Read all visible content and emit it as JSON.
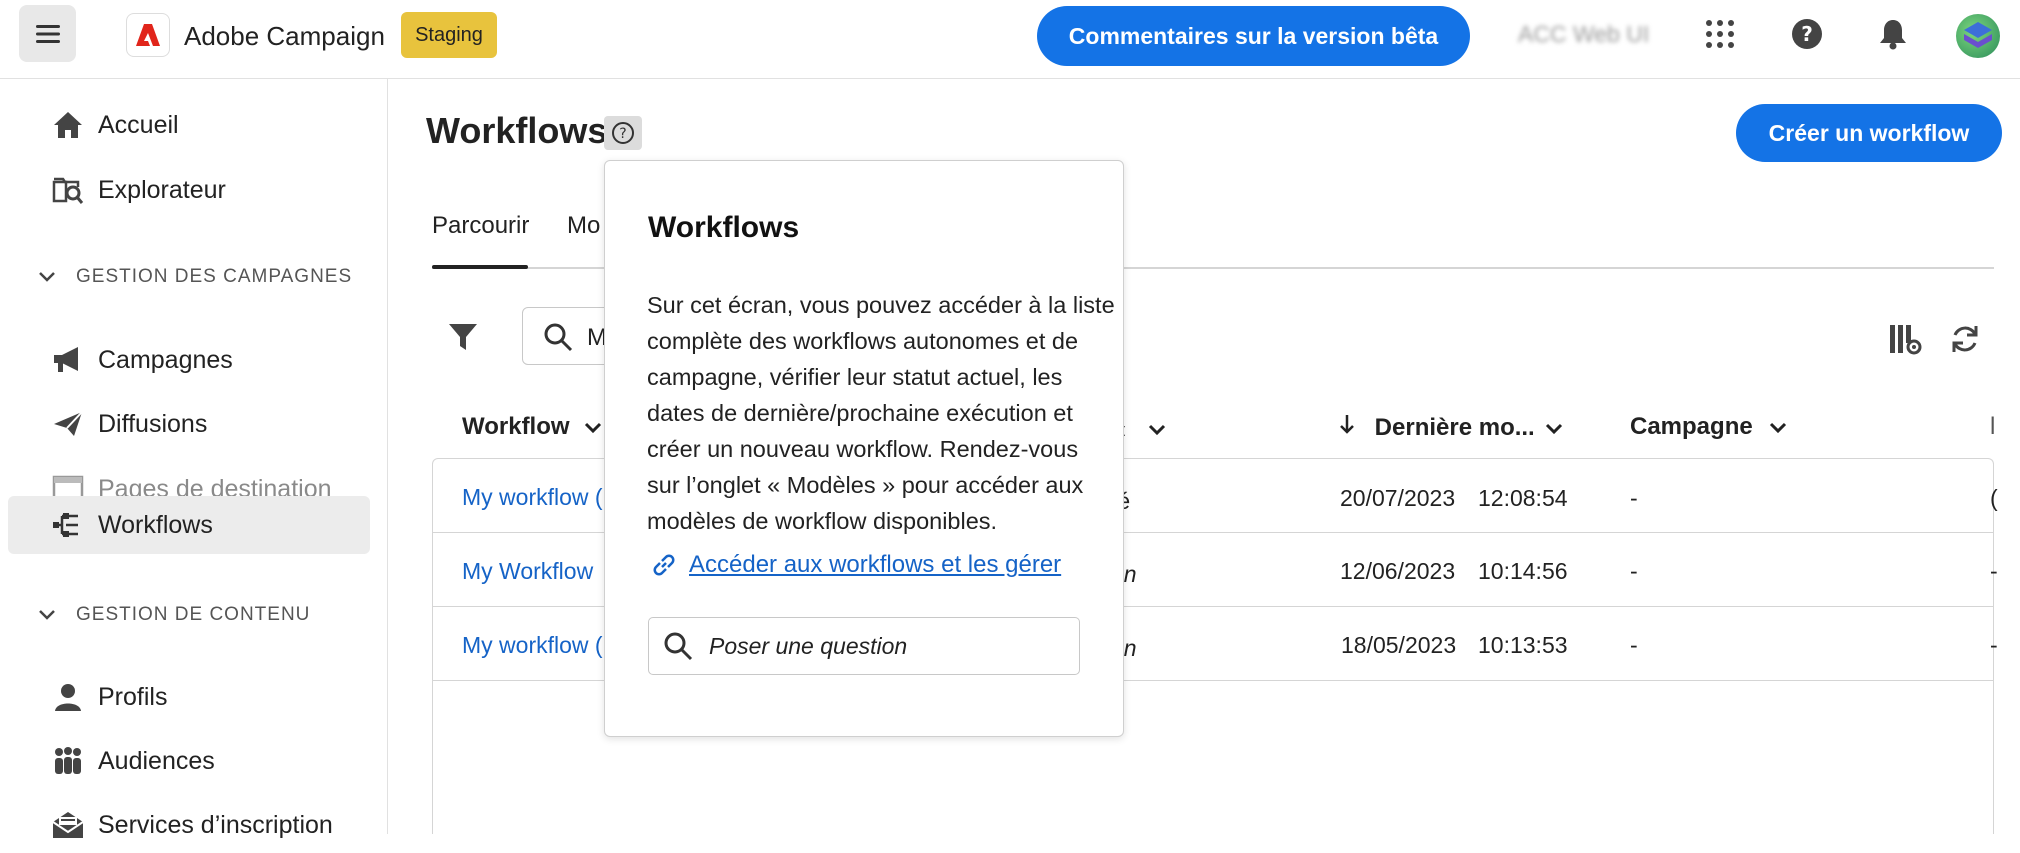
{
  "header": {
    "app_name": "Adobe Campaign",
    "env_badge": "Staging",
    "beta_feedback": "Commentaires sur la version bêta",
    "org_name": "ACC Web UI",
    "icons": [
      "menu-icon",
      "apps-grid-icon",
      "help-icon",
      "bell-icon",
      "avatar"
    ]
  },
  "sidebar": {
    "items_top": [
      {
        "label": "Accueil",
        "icon": "home-icon"
      },
      {
        "label": "Explorateur",
        "icon": "explorer-icon"
      }
    ],
    "section1": "GESTION DES CAMPAGNES",
    "items_campaigns": [
      {
        "label": "Campagnes",
        "icon": "megaphone-icon"
      },
      {
        "label": "Diffusions",
        "icon": "send-icon"
      },
      {
        "label": "Pages de destination",
        "icon": "landing-page-icon",
        "muted": true
      },
      {
        "label": "Workflows",
        "icon": "workflow-icon",
        "active": true
      }
    ],
    "section2": "GESTION DE CONTENU",
    "items_content": [
      {
        "label": "Profils",
        "icon": "user-icon"
      },
      {
        "label": "Audiences",
        "icon": "audiences-icon"
      },
      {
        "label": "Services d’inscription",
        "icon": "subscription-icon"
      }
    ]
  },
  "main": {
    "title": "Workflows",
    "create_button": "Créer un workflow",
    "tabs": [
      "Parcourir",
      "Mo"
    ],
    "search_value": "M",
    "columns": {
      "workflow": "Workflow",
      "status_partial": "ut",
      "last_modified": "Dernière mo...",
      "campaign": "Campagne",
      "extra": "l"
    },
    "rows": [
      {
        "name": "My workflow (",
        "status": "té",
        "date": "20/07/2023",
        "time": "12:08:54",
        "campaign": "-",
        "extra": "("
      },
      {
        "name": "My Workflow",
        "status": "on",
        "date": "12/06/2023",
        "time": "10:14:56",
        "campaign": "-",
        "extra": "-"
      },
      {
        "name": "My workflow (",
        "status": "on",
        "date": "18/05/2023",
        "time": "10:13:53",
        "campaign": "-",
        "extra": "-"
      }
    ]
  },
  "popover": {
    "title": "Workflows",
    "body": "Sur cet écran, vous pouvez accéder à la liste complète des workflows autonomes et de campagne, vérifier leur statut actuel, les dates de dernière/prochaine exécution et créer un nouveau workflow. Rendez-vous sur l’onglet « Modèles » pour accéder aux modèles de workflow  disponibles.",
    "link": "Accéder aux workflows et les gérer",
    "ask_placeholder": "Poser une question"
  },
  "colors": {
    "accent": "#1473e6",
    "badge": "#e8c33d",
    "link": "#1563c7"
  }
}
